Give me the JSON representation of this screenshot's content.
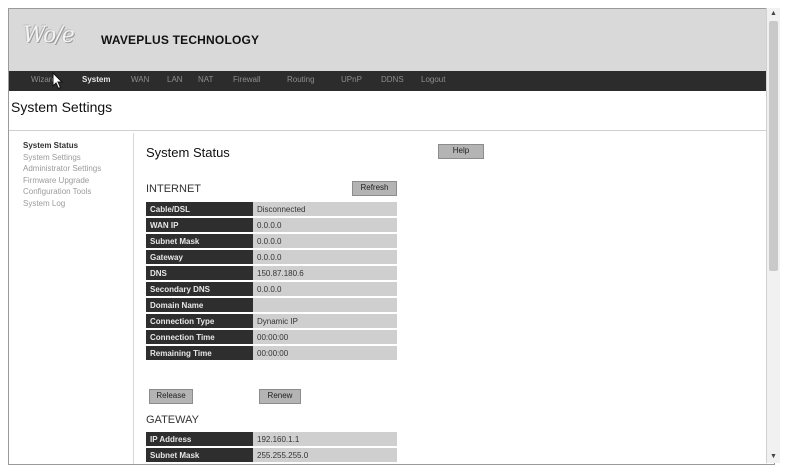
{
  "header": {
    "logo_text": "Wo/e",
    "brand": "WAVEPLUS TECHNOLOGY"
  },
  "nav": {
    "items": [
      "Wizard",
      "System",
      "WAN",
      "LAN",
      "NAT",
      "Firewall",
      "Routing",
      "UPnP",
      "DDNS",
      "Logout"
    ],
    "active": "System"
  },
  "page": {
    "title": "System Settings"
  },
  "sidebar": {
    "items": [
      "System Status",
      "System Settings",
      "Administrator Settings",
      "Firmware Upgrade",
      "Configuration Tools",
      "System Log"
    ],
    "active": "System Status"
  },
  "main": {
    "title": "System Status",
    "help_label": "Help",
    "internet": {
      "title": "INTERNET",
      "refresh_label": "Refresh",
      "rows": [
        {
          "label": "Cable/DSL",
          "value": "Disconnected"
        },
        {
          "label": "WAN IP",
          "value": "0.0.0.0"
        },
        {
          "label": "Subnet Mask",
          "value": "0.0.0.0"
        },
        {
          "label": "Gateway",
          "value": "0.0.0.0"
        },
        {
          "label": "DNS",
          "value": "150.87.180.6"
        },
        {
          "label": "Secondary DNS",
          "value": "0.0.0.0"
        },
        {
          "label": "Domain Name",
          "value": ""
        },
        {
          "label": "Connection Type",
          "value": "Dynamic IP"
        },
        {
          "label": "Connection Time",
          "value": "00:00:00"
        },
        {
          "label": "Remaining Time",
          "value": "00:00:00"
        }
      ],
      "release_label": "Release",
      "renew_label": "Renew"
    },
    "gateway": {
      "title": "GATEWAY",
      "rows": [
        {
          "label": "IP Address",
          "value": "192.160.1.1"
        },
        {
          "label": "Subnet Mask",
          "value": "255.255.255.0"
        }
      ]
    }
  },
  "scrollbar": {
    "up_arrow": "▲",
    "down_arrow": "▼"
  }
}
